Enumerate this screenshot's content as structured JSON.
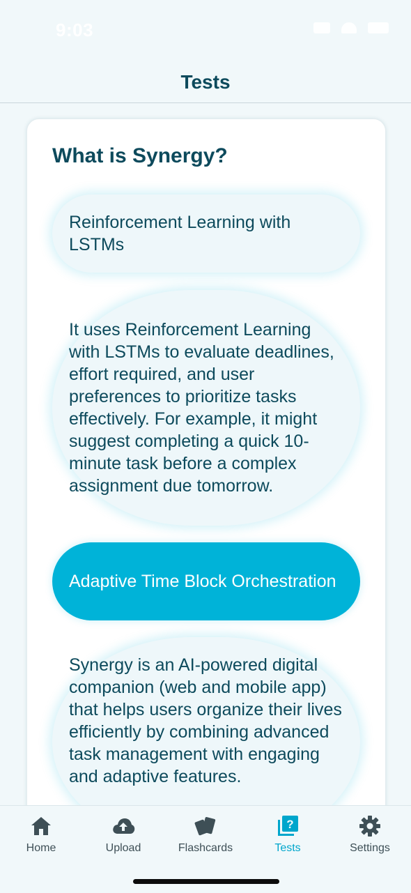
{
  "status": {
    "time": "9:03"
  },
  "header": {
    "title": "Tests"
  },
  "question": {
    "text": "What is Synergy?"
  },
  "options": [
    {
      "label": "Reinforcement Learning with LSTMs",
      "selected": false
    },
    {
      "label": "It uses Reinforcement Learning with LSTMs to evaluate deadlines, effort required, and user preferences to prioritize tasks effectively. For example, it might suggest completing a quick 10-minute task before a complex assignment due tomorrow.",
      "selected": false
    },
    {
      "label": "Adaptive Time Block Orchestration",
      "selected": true
    },
    {
      "label": "Synergy is an AI-powered digital companion (web and mobile app) that helps users organize their lives efficiently by combining advanced task management with engaging and adaptive features.",
      "selected": false
    }
  ],
  "tabs": [
    {
      "label": "Home",
      "icon": "home-icon",
      "active": false
    },
    {
      "label": "Upload",
      "icon": "cloud-upload-icon",
      "active": false
    },
    {
      "label": "Flashcards",
      "icon": "cards-icon",
      "active": false
    },
    {
      "label": "Tests",
      "icon": "quiz-icon",
      "active": true
    },
    {
      "label": "Settings",
      "icon": "gear-icon",
      "active": false
    }
  ],
  "colors": {
    "accent": "#00b3d8",
    "text": "#0d4a5c",
    "background": "#f1f8fa"
  }
}
